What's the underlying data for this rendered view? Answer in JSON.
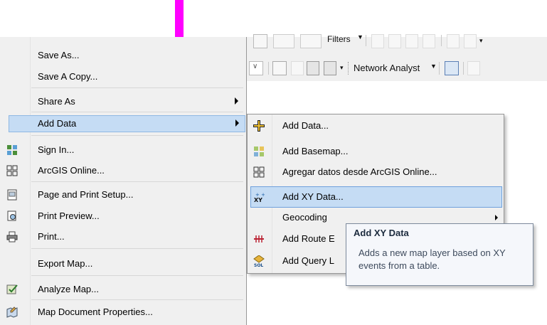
{
  "toolbar": {
    "filters_label": "Filters",
    "network_analyst_label": "Network Analyst"
  },
  "main_menu": {
    "items": [
      {
        "label": "Save As...",
        "icon": "none"
      },
      {
        "label": "Save A Copy...",
        "icon": "none"
      },
      {
        "label": "Share As",
        "icon": "none",
        "submenu": true
      },
      {
        "label": "Add Data",
        "icon": "none",
        "submenu": true,
        "highlighted": true
      },
      {
        "label": "Sign In...",
        "icon": "sign-in-icon"
      },
      {
        "label": "ArcGIS Online...",
        "icon": "arcgis-online-icon"
      },
      {
        "label": "Page and Print Setup...",
        "icon": "page-setup-icon"
      },
      {
        "label": "Print Preview...",
        "icon": "print-preview-icon"
      },
      {
        "label": "Print...",
        "icon": "printer-icon"
      },
      {
        "label": "Export Map...",
        "icon": "none"
      },
      {
        "label": "Analyze Map...",
        "icon": "analyze-map-icon"
      },
      {
        "label": "Map Document Properties...",
        "icon": "map-properties-icon"
      }
    ]
  },
  "submenu": {
    "items": [
      {
        "label": "Add Data...",
        "icon": "add-data-plus-icon"
      },
      {
        "label": "Add Basemap...",
        "icon": "basemap-icon"
      },
      {
        "label": "Agregar datos desde ArcGIS Online...",
        "icon": "arcgis-online-grid-icon"
      },
      {
        "label": "Add XY Data...",
        "icon": "xy-data-icon",
        "highlighted": true
      },
      {
        "label": "Geocoding",
        "icon": "none",
        "submenu": true
      },
      {
        "label": "Add Route E",
        "icon": "route-events-icon"
      },
      {
        "label": "Add Query L",
        "icon": "sql-query-icon"
      }
    ]
  },
  "tooltip": {
    "title": "Add XY Data",
    "body": "Adds a new map layer based on XY events from a table."
  },
  "colors": {
    "highlight": "#c5dcf4",
    "annotation_arrow": "#ff00ff"
  }
}
